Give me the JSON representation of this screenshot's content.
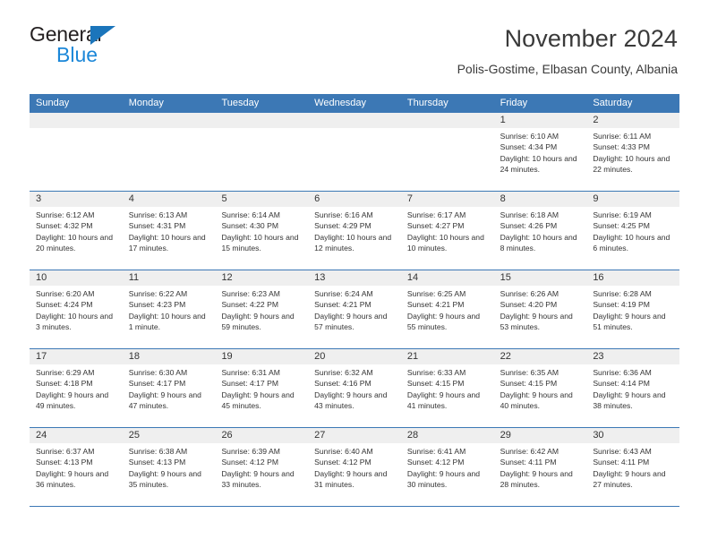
{
  "brand": {
    "line1": "General",
    "line2": "Blue",
    "triangle_color": "#1b75bb",
    "line2_color": "#1b87d8"
  },
  "header": {
    "title": "November 2024",
    "subtitle": "Polis-Gostime, Elbasan County, Albania"
  },
  "calendar": {
    "accent_color": "#3c78b5",
    "daynum_bg": "#efefef",
    "weekdays": [
      "Sunday",
      "Monday",
      "Tuesday",
      "Wednesday",
      "Thursday",
      "Friday",
      "Saturday"
    ],
    "weeks": [
      [
        {
          "day": "",
          "sunrise": "",
          "sunset": "",
          "daylight": "",
          "empty": true
        },
        {
          "day": "",
          "sunrise": "",
          "sunset": "",
          "daylight": "",
          "empty": true
        },
        {
          "day": "",
          "sunrise": "",
          "sunset": "",
          "daylight": "",
          "empty": true
        },
        {
          "day": "",
          "sunrise": "",
          "sunset": "",
          "daylight": "",
          "empty": true
        },
        {
          "day": "",
          "sunrise": "",
          "sunset": "",
          "daylight": "",
          "empty": true
        },
        {
          "day": "1",
          "sunrise": "Sunrise: 6:10 AM",
          "sunset": "Sunset: 4:34 PM",
          "daylight": "Daylight: 10 hours and 24 minutes."
        },
        {
          "day": "2",
          "sunrise": "Sunrise: 6:11 AM",
          "sunset": "Sunset: 4:33 PM",
          "daylight": "Daylight: 10 hours and 22 minutes."
        }
      ],
      [
        {
          "day": "3",
          "sunrise": "Sunrise: 6:12 AM",
          "sunset": "Sunset: 4:32 PM",
          "daylight": "Daylight: 10 hours and 20 minutes."
        },
        {
          "day": "4",
          "sunrise": "Sunrise: 6:13 AM",
          "sunset": "Sunset: 4:31 PM",
          "daylight": "Daylight: 10 hours and 17 minutes."
        },
        {
          "day": "5",
          "sunrise": "Sunrise: 6:14 AM",
          "sunset": "Sunset: 4:30 PM",
          "daylight": "Daylight: 10 hours and 15 minutes."
        },
        {
          "day": "6",
          "sunrise": "Sunrise: 6:16 AM",
          "sunset": "Sunset: 4:29 PM",
          "daylight": "Daylight: 10 hours and 12 minutes."
        },
        {
          "day": "7",
          "sunrise": "Sunrise: 6:17 AM",
          "sunset": "Sunset: 4:27 PM",
          "daylight": "Daylight: 10 hours and 10 minutes."
        },
        {
          "day": "8",
          "sunrise": "Sunrise: 6:18 AM",
          "sunset": "Sunset: 4:26 PM",
          "daylight": "Daylight: 10 hours and 8 minutes."
        },
        {
          "day": "9",
          "sunrise": "Sunrise: 6:19 AM",
          "sunset": "Sunset: 4:25 PM",
          "daylight": "Daylight: 10 hours and 6 minutes."
        }
      ],
      [
        {
          "day": "10",
          "sunrise": "Sunrise: 6:20 AM",
          "sunset": "Sunset: 4:24 PM",
          "daylight": "Daylight: 10 hours and 3 minutes."
        },
        {
          "day": "11",
          "sunrise": "Sunrise: 6:22 AM",
          "sunset": "Sunset: 4:23 PM",
          "daylight": "Daylight: 10 hours and 1 minute."
        },
        {
          "day": "12",
          "sunrise": "Sunrise: 6:23 AM",
          "sunset": "Sunset: 4:22 PM",
          "daylight": "Daylight: 9 hours and 59 minutes."
        },
        {
          "day": "13",
          "sunrise": "Sunrise: 6:24 AM",
          "sunset": "Sunset: 4:21 PM",
          "daylight": "Daylight: 9 hours and 57 minutes."
        },
        {
          "day": "14",
          "sunrise": "Sunrise: 6:25 AM",
          "sunset": "Sunset: 4:21 PM",
          "daylight": "Daylight: 9 hours and 55 minutes."
        },
        {
          "day": "15",
          "sunrise": "Sunrise: 6:26 AM",
          "sunset": "Sunset: 4:20 PM",
          "daylight": "Daylight: 9 hours and 53 minutes."
        },
        {
          "day": "16",
          "sunrise": "Sunrise: 6:28 AM",
          "sunset": "Sunset: 4:19 PM",
          "daylight": "Daylight: 9 hours and 51 minutes."
        }
      ],
      [
        {
          "day": "17",
          "sunrise": "Sunrise: 6:29 AM",
          "sunset": "Sunset: 4:18 PM",
          "daylight": "Daylight: 9 hours and 49 minutes."
        },
        {
          "day": "18",
          "sunrise": "Sunrise: 6:30 AM",
          "sunset": "Sunset: 4:17 PM",
          "daylight": "Daylight: 9 hours and 47 minutes."
        },
        {
          "day": "19",
          "sunrise": "Sunrise: 6:31 AM",
          "sunset": "Sunset: 4:17 PM",
          "daylight": "Daylight: 9 hours and 45 minutes."
        },
        {
          "day": "20",
          "sunrise": "Sunrise: 6:32 AM",
          "sunset": "Sunset: 4:16 PM",
          "daylight": "Daylight: 9 hours and 43 minutes."
        },
        {
          "day": "21",
          "sunrise": "Sunrise: 6:33 AM",
          "sunset": "Sunset: 4:15 PM",
          "daylight": "Daylight: 9 hours and 41 minutes."
        },
        {
          "day": "22",
          "sunrise": "Sunrise: 6:35 AM",
          "sunset": "Sunset: 4:15 PM",
          "daylight": "Daylight: 9 hours and 40 minutes."
        },
        {
          "day": "23",
          "sunrise": "Sunrise: 6:36 AM",
          "sunset": "Sunset: 4:14 PM",
          "daylight": "Daylight: 9 hours and 38 minutes."
        }
      ],
      [
        {
          "day": "24",
          "sunrise": "Sunrise: 6:37 AM",
          "sunset": "Sunset: 4:13 PM",
          "daylight": "Daylight: 9 hours and 36 minutes."
        },
        {
          "day": "25",
          "sunrise": "Sunrise: 6:38 AM",
          "sunset": "Sunset: 4:13 PM",
          "daylight": "Daylight: 9 hours and 35 minutes."
        },
        {
          "day": "26",
          "sunrise": "Sunrise: 6:39 AM",
          "sunset": "Sunset: 4:12 PM",
          "daylight": "Daylight: 9 hours and 33 minutes."
        },
        {
          "day": "27",
          "sunrise": "Sunrise: 6:40 AM",
          "sunset": "Sunset: 4:12 PM",
          "daylight": "Daylight: 9 hours and 31 minutes."
        },
        {
          "day": "28",
          "sunrise": "Sunrise: 6:41 AM",
          "sunset": "Sunset: 4:12 PM",
          "daylight": "Daylight: 9 hours and 30 minutes."
        },
        {
          "day": "29",
          "sunrise": "Sunrise: 6:42 AM",
          "sunset": "Sunset: 4:11 PM",
          "daylight": "Daylight: 9 hours and 28 minutes."
        },
        {
          "day": "30",
          "sunrise": "Sunrise: 6:43 AM",
          "sunset": "Sunset: 4:11 PM",
          "daylight": "Daylight: 9 hours and 27 minutes."
        }
      ]
    ]
  }
}
